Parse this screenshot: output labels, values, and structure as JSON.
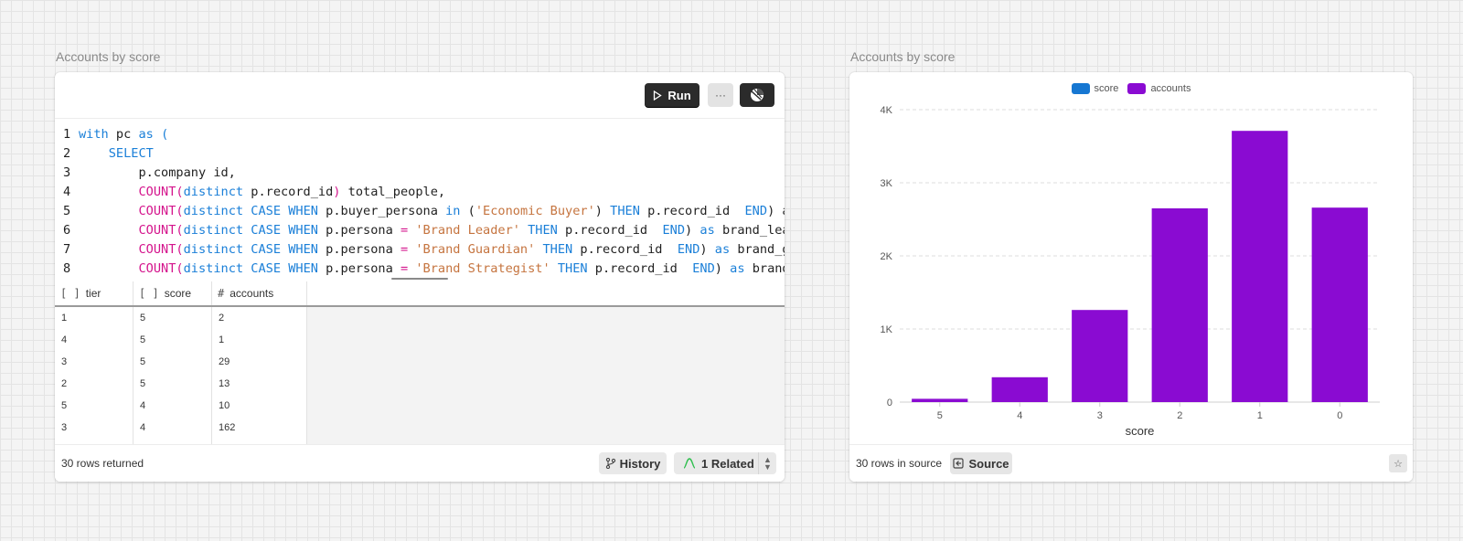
{
  "left_panel": {
    "title": "Accounts by score",
    "toolbar": {
      "run_label": "Run",
      "more_label": "···"
    },
    "code": {
      "lines": [
        {
          "n": "1",
          "tokens": [
            {
              "t": "with",
              "c": "kw"
            },
            {
              "t": " pc "
            },
            {
              "t": "as",
              "c": "kw"
            },
            {
              "t": " "
            },
            {
              "t": "(",
              "c": "kw"
            }
          ]
        },
        {
          "n": "2",
          "tokens": [
            {
              "t": "    "
            },
            {
              "t": "SELECT",
              "c": "kw"
            }
          ]
        },
        {
          "n": "3",
          "tokens": [
            {
              "t": "        p.company id,"
            }
          ]
        },
        {
          "n": "4",
          "tokens": [
            {
              "t": "        "
            },
            {
              "t": "COUNT",
              "c": "fn"
            },
            {
              "t": "(",
              "c": "fn"
            },
            {
              "t": "distinct",
              "c": "kw"
            },
            {
              "t": " p.record_id"
            },
            {
              "t": ")",
              "c": "fn"
            },
            {
              "t": " total_people,"
            }
          ]
        },
        {
          "n": "5",
          "tokens": [
            {
              "t": "        "
            },
            {
              "t": "COUNT",
              "c": "fn"
            },
            {
              "t": "(",
              "c": "fn"
            },
            {
              "t": "distinct",
              "c": "kw"
            },
            {
              "t": " "
            },
            {
              "t": "CASE",
              "c": "kw"
            },
            {
              "t": " "
            },
            {
              "t": "WHEN",
              "c": "kw"
            },
            {
              "t": " p.buyer_persona "
            },
            {
              "t": "in",
              "c": "kw"
            },
            {
              "t": " ("
            },
            {
              "t": "'Economic Buyer'",
              "c": "st"
            },
            {
              "t": ") "
            },
            {
              "t": "THEN",
              "c": "kw"
            },
            {
              "t": " p.record_id  "
            },
            {
              "t": "END",
              "c": "kw"
            },
            {
              "t": ") as economic_buyer_count,"
            }
          ]
        },
        {
          "n": "6",
          "tokens": [
            {
              "t": "        "
            },
            {
              "t": "COUNT",
              "c": "fn"
            },
            {
              "t": "(",
              "c": "fn"
            },
            {
              "t": "distinct",
              "c": "kw"
            },
            {
              "t": " "
            },
            {
              "t": "CASE",
              "c": "kw"
            },
            {
              "t": " "
            },
            {
              "t": "WHEN",
              "c": "kw"
            },
            {
              "t": " p.persona "
            },
            {
              "t": "=",
              "c": "fn"
            },
            {
              "t": " "
            },
            {
              "t": "'Brand Leader'",
              "c": "st"
            },
            {
              "t": " "
            },
            {
              "t": "THEN",
              "c": "kw"
            },
            {
              "t": " p.record_id  "
            },
            {
              "t": "END",
              "c": "kw"
            },
            {
              "t": ") "
            },
            {
              "t": "as",
              "c": "kw"
            },
            {
              "t": " brand_leader_count,"
            }
          ]
        },
        {
          "n": "7",
          "tokens": [
            {
              "t": "        "
            },
            {
              "t": "COUNT",
              "c": "fn"
            },
            {
              "t": "(",
              "c": "fn"
            },
            {
              "t": "distinct",
              "c": "kw"
            },
            {
              "t": " "
            },
            {
              "t": "CASE",
              "c": "kw"
            },
            {
              "t": " "
            },
            {
              "t": "WHEN",
              "c": "kw"
            },
            {
              "t": " p.persona "
            },
            {
              "t": "=",
              "c": "fn"
            },
            {
              "t": " "
            },
            {
              "t": "'Brand Guardian'",
              "c": "st"
            },
            {
              "t": " "
            },
            {
              "t": "THEN",
              "c": "kw"
            },
            {
              "t": " p.record_id  "
            },
            {
              "t": "END",
              "c": "kw"
            },
            {
              "t": ") "
            },
            {
              "t": "as",
              "c": "kw"
            },
            {
              "t": " brand_guardian_count,"
            }
          ]
        },
        {
          "n": "8",
          "tokens": [
            {
              "t": "        "
            },
            {
              "t": "COUNT",
              "c": "fn"
            },
            {
              "t": "(",
              "c": "fn"
            },
            {
              "t": "distinct",
              "c": "kw"
            },
            {
              "t": " "
            },
            {
              "t": "CASE",
              "c": "kw"
            },
            {
              "t": " "
            },
            {
              "t": "WHEN",
              "c": "kw"
            },
            {
              "t": " p.persona "
            },
            {
              "t": "=",
              "c": "fn"
            },
            {
              "t": " "
            },
            {
              "t": "'Brand Strategist'",
              "c": "st"
            },
            {
              "t": " "
            },
            {
              "t": "THEN",
              "c": "kw"
            },
            {
              "t": " p.record_id  "
            },
            {
              "t": "END",
              "c": "kw"
            },
            {
              "t": ") "
            },
            {
              "t": "as",
              "c": "kw"
            },
            {
              "t": " brand_strategist_count,"
            }
          ]
        }
      ]
    },
    "grid": {
      "columns": [
        {
          "icon": "[]",
          "label": "tier"
        },
        {
          "icon": "[]",
          "label": "score"
        },
        {
          "icon": "#",
          "label": "accounts"
        }
      ],
      "rows": [
        [
          "1",
          "5",
          "2"
        ],
        [
          "4",
          "5",
          "1"
        ],
        [
          "3",
          "5",
          "29"
        ],
        [
          "2",
          "5",
          "13"
        ],
        [
          "5",
          "4",
          "10"
        ],
        [
          "3",
          "4",
          "162"
        ],
        [
          "",
          "",
          ""
        ]
      ]
    },
    "footer": {
      "rows_text": "30 rows returned",
      "history_label": "History",
      "related_label": "1 Related"
    }
  },
  "right_panel": {
    "title": "Accounts by score",
    "footer": {
      "rows_text": "30 rows in source",
      "source_label": "Source"
    }
  },
  "chart_data": {
    "type": "bar",
    "categories": [
      "5",
      "4",
      "3",
      "2",
      "1",
      "0"
    ],
    "series": [
      {
        "name": "score",
        "color": "#1677d2",
        "values": [
          0,
          0,
          0,
          0,
          0,
          0
        ]
      },
      {
        "name": "accounts",
        "color": "#8a0bd2",
        "values": [
          45,
          340,
          1260,
          2650,
          3710,
          2660
        ]
      }
    ],
    "xlabel": "score",
    "ylabel": "",
    "ylim": [
      0,
      4000
    ],
    "yticks": [
      0,
      1000,
      2000,
      3000,
      4000
    ],
    "ytick_labels": [
      "0",
      "1K",
      "2K",
      "3K",
      "4K"
    ],
    "legend": "top-center",
    "grid": true
  }
}
